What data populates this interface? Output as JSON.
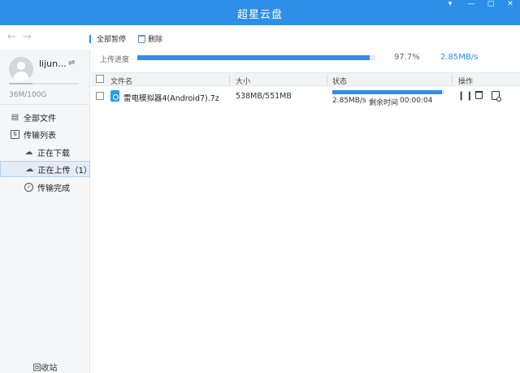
{
  "window": {
    "title": "超星云盘",
    "controls": {
      "menu": "▾",
      "minimize": "—",
      "maximize": "□",
      "close": "✕"
    }
  },
  "toolbar": {
    "back_icon": "arrow-left-icon",
    "forward_icon": "arrow-right-icon",
    "pause_all_label": "全部暂停",
    "delete_label": "删除"
  },
  "sidebar": {
    "username": "lijun...",
    "switch_glyph": "⇌",
    "quota_text": "36M/100G",
    "quota_fraction": 0.34,
    "items": [
      {
        "label": "全部文件",
        "icon": "document-icon"
      },
      {
        "label": "传输列表",
        "icon": "transfer-icon"
      },
      {
        "label": "正在下载",
        "icon": "cloud-download-icon"
      },
      {
        "label": "正在上传（1）",
        "icon": "cloud-upload-icon"
      },
      {
        "label": "传输完成",
        "icon": "check-circle-icon"
      }
    ],
    "recycle_label": "回收站"
  },
  "summary": {
    "label": "上传进度",
    "percent_text": "97.7%",
    "progress_fraction": 0.977,
    "speed": "2.85MB/s"
  },
  "table": {
    "headers": {
      "name": "文件名",
      "size": "大小",
      "status": "状态",
      "actions": "操作"
    },
    "rows": [
      {
        "name": "雷电模拟器4(Android7).7z",
        "size": "538MB/551MB",
        "progress_fraction": 0.977,
        "speed": "2.85MB/s",
        "remaining_label": "剩余时间",
        "remaining_time": "00:00:04"
      }
    ]
  },
  "colors": {
    "accent": "#2d8fe8",
    "titlebar": "#2d8fe8",
    "sidebar_bg": "#f5f6f7",
    "selected_bg": "#e3ecf6"
  }
}
